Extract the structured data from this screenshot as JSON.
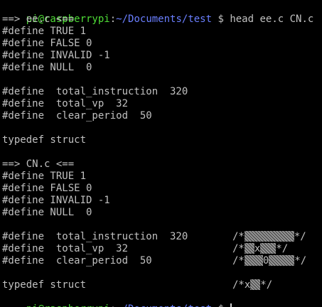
{
  "terminal": {
    "prompt_user_host": "pi@raspberrypi",
    "prompt_separator": ":",
    "prompt_path": "~/Documents/test",
    "prompt_symbol": " $ ",
    "command": "head ee.c CN.c",
    "header_ee": "==> ee.c <==",
    "header_cn": "==> CN.c <==",
    "lines": {
      "define_true": "#define TRUE 1",
      "define_false": "#define FALSE 0",
      "define_invalid": "#define INVALID -1",
      "define_null": "#define NULL  0",
      "define_total_instruction": "#define  total_instruction  320",
      "define_total_vp": "#define  total_vp  32",
      "define_clear_period": "#define  clear_period  50",
      "typedef_struct": "typedef struct"
    },
    "comment_art": {
      "open": "/*",
      "close": "*/",
      "mark_x": "x",
      "mark_zero": "0"
    },
    "colors": {
      "background": "#000000",
      "text": "#c0c0c0",
      "prompt_user": "#4edc36",
      "prompt_path": "#6a7fff"
    }
  }
}
